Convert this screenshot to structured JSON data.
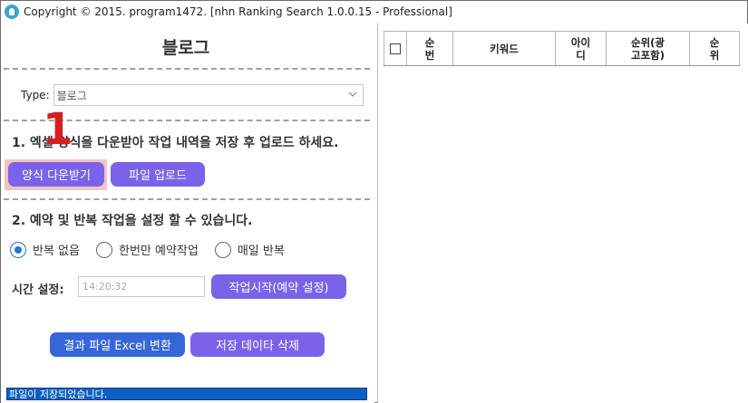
{
  "window": {
    "title": "Copyright © 2015. program1472. [nhn Ranking Search 1.0.0.15 - Professional]",
    "icon": "app-icon"
  },
  "left": {
    "title": "블로그",
    "type_label": "Type:",
    "type_value": "블로그",
    "step1": "1. 엑셀 양식을 다운받아 작업 내역을 저장 후 업로드 하세요.",
    "annotation_number": "1",
    "download_button": "양식 다운받기",
    "upload_button": "파일 업로드",
    "step2": "2. 예약 및 반복 작업을 설정 할 수 있습니다.",
    "radio": [
      {
        "label": "반복 없음",
        "selected": true
      },
      {
        "label": "한번만 예약작업",
        "selected": false
      },
      {
        "label": "매일 반복",
        "selected": false
      }
    ],
    "time_label": "시간 설정:",
    "time_value": "14:20:32",
    "start_button": "작업시작(예약 설정)",
    "excel_button": "결과 파일 Excel 변환",
    "delete_button": "저장 데이타 삭제",
    "status": "파일이 저장되었습니다."
  },
  "grid": {
    "columns": [
      "순\n번",
      "키워드",
      "아이\n디",
      "순위(광\n고포함)",
      "순\n위"
    ]
  },
  "colors": {
    "purple_button": "#7a63e8",
    "blue_button": "#3567d8",
    "annotation_red": "#d42020",
    "highlight": "#f3b7b7",
    "status_bar": "#0f5fc0"
  }
}
